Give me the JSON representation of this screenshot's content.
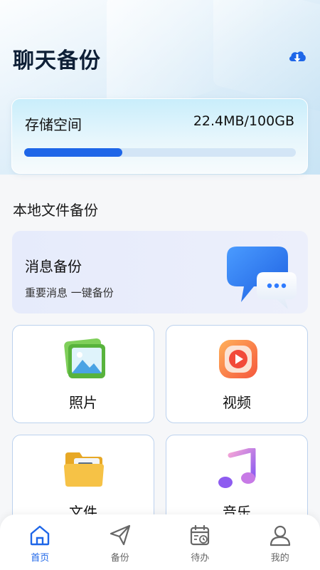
{
  "header": {
    "title": "聊天备份"
  },
  "storage": {
    "label": "存储空间",
    "value": "22.4MB/100GB",
    "progress_fraction": 0.36
  },
  "section": {
    "title": "本地文件备份"
  },
  "message_backup": {
    "title": "消息备份",
    "subtitle": "重要消息 一键备份"
  },
  "tiles": [
    {
      "label": "照片",
      "icon": "photo-icon"
    },
    {
      "label": "视频",
      "icon": "video-icon"
    },
    {
      "label": "文件",
      "icon": "folder-icon"
    },
    {
      "label": "音乐",
      "icon": "music-icon"
    }
  ],
  "nav": {
    "items": [
      {
        "label": "首页",
        "icon": "home-icon",
        "active": true
      },
      {
        "label": "备份",
        "icon": "send-icon",
        "active": false
      },
      {
        "label": "待办",
        "icon": "calendar-icon",
        "active": false
      },
      {
        "label": "我的",
        "icon": "user-icon",
        "active": false
      }
    ]
  },
  "colors": {
    "accent": "#1e66e8",
    "title": "#0e1f36",
    "track": "#d3e5f6",
    "nav_inactive": "#666666"
  }
}
